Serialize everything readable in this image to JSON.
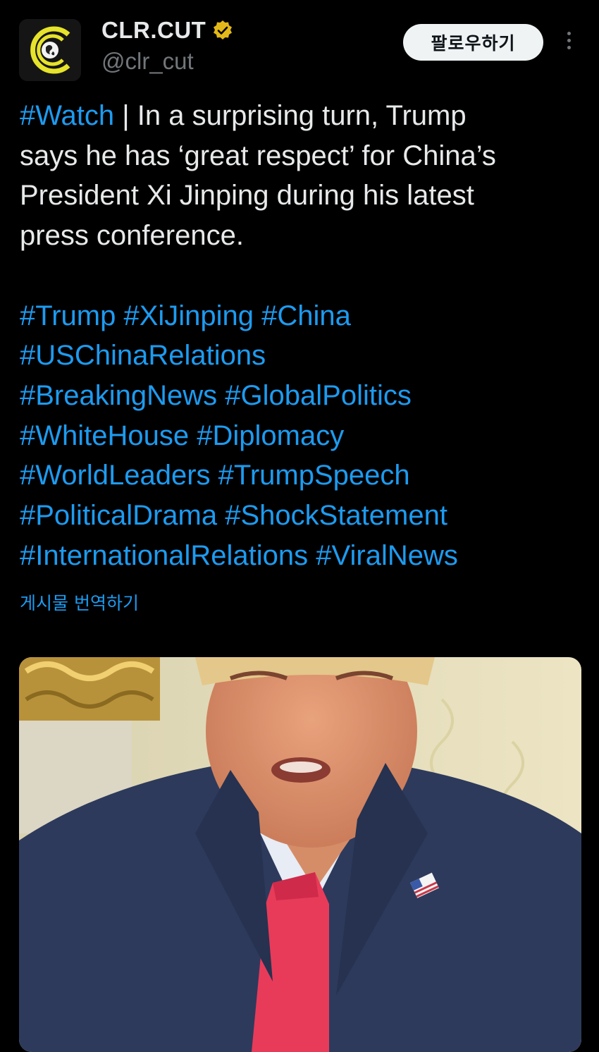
{
  "author": {
    "display_name": "CLR.CUT",
    "handle": "@clr_cut",
    "avatar_icon": "clr-cut-logo-icon",
    "verified_icon": "verified-badge-icon",
    "verified_color": "#e2b719"
  },
  "header": {
    "follow_label": "팔로우하기",
    "more_icon": "more-options-icon"
  },
  "tweet": {
    "lines": [
      [
        {
          "t": "#Watch",
          "h": true
        },
        {
          "t": " | In a surprising turn, Trump",
          "h": false
        }
      ],
      [
        {
          "t": "says he has ‘great respect’ for China’s",
          "h": false
        }
      ],
      [
        {
          "t": "President Xi Jinping during his latest",
          "h": false
        }
      ],
      [
        {
          "t": "press conference.",
          "h": false
        }
      ]
    ],
    "hashtag_lines": [
      [
        "#Trump",
        "#XiJinping",
        "#China"
      ],
      [
        "#USChinaRelations"
      ],
      [
        "#BreakingNews",
        "#GlobalPolitics"
      ],
      [
        "#WhiteHouse",
        "#Diplomacy"
      ],
      [
        "#WorldLeaders",
        "#TrumpSpeech"
      ],
      [
        "#PoliticalDrama",
        "#ShockStatement"
      ],
      [
        "#InternationalRelations",
        "#ViralNews"
      ]
    ],
    "translate_label": "게시물 번역하기"
  },
  "colors": {
    "background": "#000000",
    "text": "#e7e9ea",
    "link": "#1d9bf0",
    "muted": "#71767b",
    "logo_yellow": "#e6e32b"
  },
  "media": {
    "type": "video-thumbnail"
  }
}
